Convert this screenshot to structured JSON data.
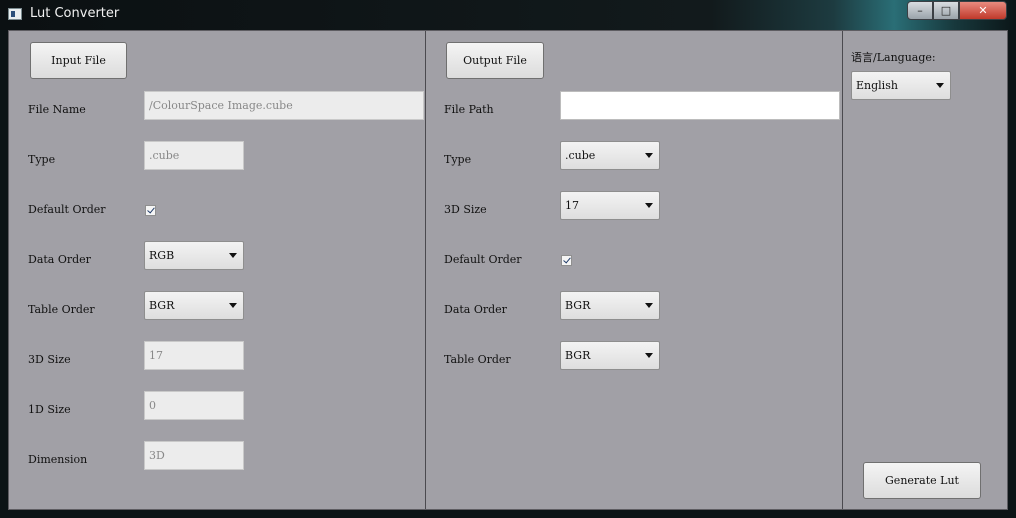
{
  "window": {
    "title": "Lut Converter",
    "minimize": "–",
    "maximize": "□",
    "close": "✕"
  },
  "input": {
    "button": "Input File",
    "file_name_label": "File Name",
    "file_name_value": "/ColourSpace Image.cube",
    "type_label": "Type",
    "type_value": ".cube",
    "default_order_label": "Default Order",
    "default_order_checked": true,
    "data_order_label": "Data Order",
    "data_order_value": "RGB",
    "table_order_label": "Table Order",
    "table_order_value": "BGR",
    "size3d_label": "3D Size",
    "size3d_value": "17",
    "size1d_label": "1D Size",
    "size1d_value": "0",
    "dimension_label": "Dimension",
    "dimension_value": "3D"
  },
  "output": {
    "button": "Output File",
    "file_path_label": "File Path",
    "file_path_value": "",
    "type_label": "Type",
    "type_value": ".cube",
    "size3d_label": "3D Size",
    "size3d_value": "17",
    "default_order_label": "Default Order",
    "default_order_checked": true,
    "data_order_label": "Data Order",
    "data_order_value": "BGR",
    "table_order_label": "Table Order",
    "table_order_value": "BGR"
  },
  "settings": {
    "language_label": "语言/Language:",
    "language_value": "English",
    "generate_button": "Generate Lut"
  }
}
